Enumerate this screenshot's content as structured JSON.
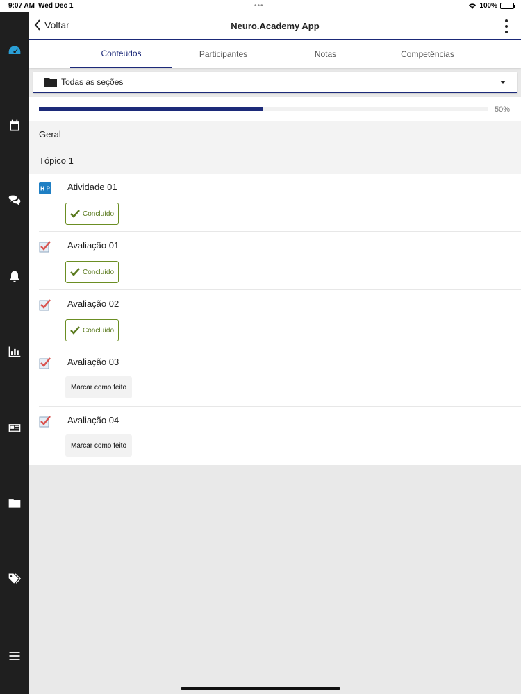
{
  "status_bar": {
    "time": "9:07 AM",
    "date": "Wed Dec 1",
    "battery": "100%"
  },
  "header": {
    "back_label": "Voltar",
    "title": "Neuro.Academy App"
  },
  "tabs": [
    {
      "label": "Conteúdos",
      "active": true
    },
    {
      "label": "Participantes",
      "active": false
    },
    {
      "label": "Notas",
      "active": false
    },
    {
      "label": "Competências",
      "active": false
    }
  ],
  "section_select": {
    "value": "Todas as seções"
  },
  "progress": {
    "percent": 50,
    "label": "50%"
  },
  "groups": [
    {
      "title": "Geral"
    },
    {
      "title": "Tópico 1"
    }
  ],
  "items": [
    {
      "name": "Atividade 01",
      "icon": "h5p-icon",
      "status": "Concluído"
    },
    {
      "name": "Avaliação 01",
      "icon": "quiz-check-icon",
      "status": "Concluído"
    },
    {
      "name": "Avaliação 02",
      "icon": "quiz-check-icon",
      "status": "Concluído"
    },
    {
      "name": "Avaliação 03",
      "icon": "quiz-check-icon",
      "action": "Marcar como feito"
    },
    {
      "name": "Avaliação 04",
      "icon": "quiz-check-icon",
      "action": "Marcar como feito"
    }
  ],
  "colors": {
    "primary": "#1c2a79",
    "done": "#6b8e23",
    "sidebar": "#1f1f1f"
  },
  "sidebar_icons": [
    "dashboard-icon",
    "calendar-icon",
    "messages-icon",
    "notifications-icon",
    "grades-icon",
    "news-icon",
    "files-icon",
    "tags-icon",
    "menu-icon"
  ]
}
